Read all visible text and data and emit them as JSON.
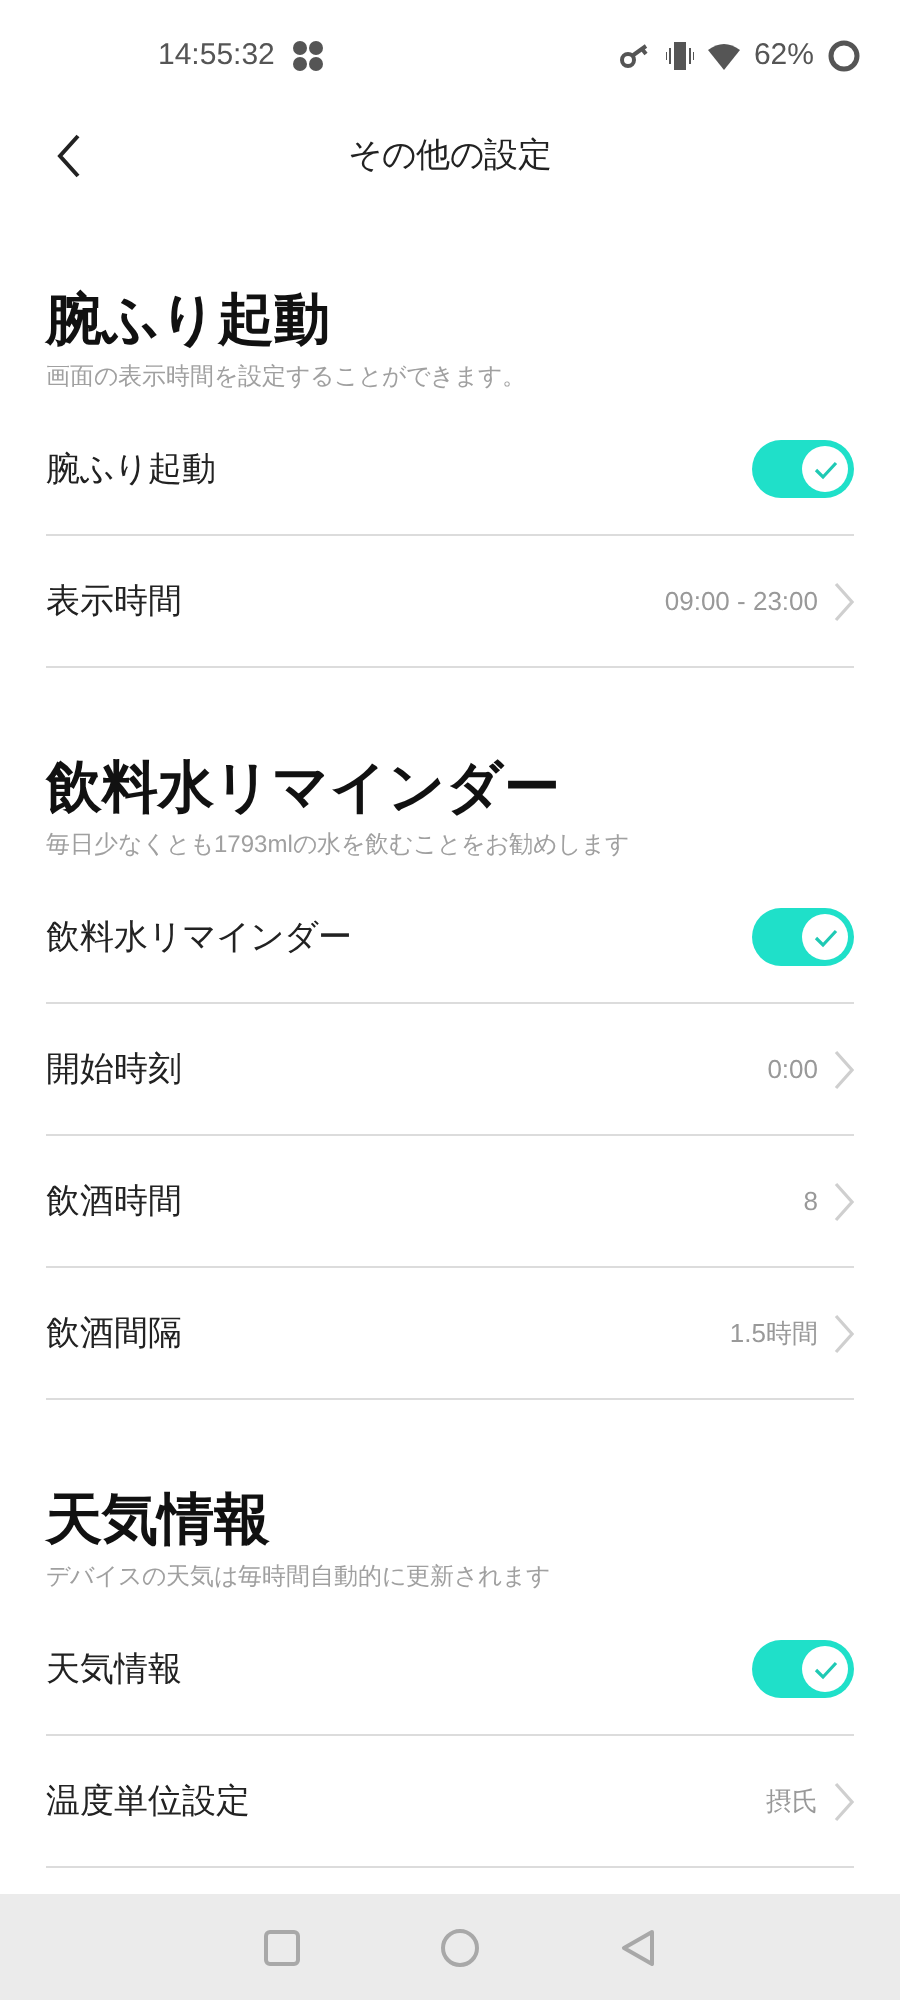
{
  "status_bar": {
    "time": "14:55:32",
    "battery": "62%"
  },
  "header": {
    "title": "その他の設定"
  },
  "sections": [
    {
      "title": "腕ふり起動",
      "subtitle": "画面の表示時間を設定することができます。",
      "rows": [
        {
          "kind": "toggle",
          "label": "腕ふり起動",
          "on": true
        },
        {
          "kind": "value",
          "label": "表示時間",
          "value": "09:00 - 23:00"
        }
      ]
    },
    {
      "title": "飲料水リマインダー",
      "subtitle": "毎日少なくとも1793mlの水を飲むことをお勧めします",
      "rows": [
        {
          "kind": "toggle",
          "label": "飲料水リマインダー",
          "on": true
        },
        {
          "kind": "value",
          "label": "開始時刻",
          "value": "0:00"
        },
        {
          "kind": "value",
          "label": "飲酒時間",
          "value": "8"
        },
        {
          "kind": "value",
          "label": "飲酒間隔",
          "value": "1.5時間"
        }
      ]
    },
    {
      "title": "天気情報",
      "subtitle": "デバイスの天気は毎時間自動的に更新されます",
      "rows": [
        {
          "kind": "toggle",
          "label": "天気情報",
          "on": true
        },
        {
          "kind": "value",
          "label": "温度単位設定",
          "value": "摂氏"
        }
      ]
    }
  ]
}
